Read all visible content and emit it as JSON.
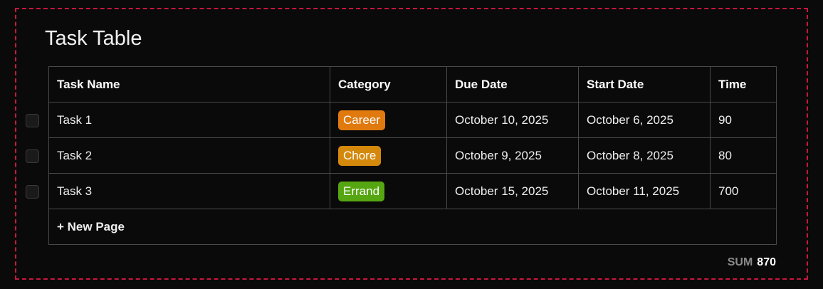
{
  "title": "Task Table",
  "table": {
    "headers": {
      "name": "Task Name",
      "category": "Category",
      "due": "Due Date",
      "start": "Start Date",
      "time": "Time"
    },
    "rows": [
      {
        "name": "Task 1",
        "category": "Career",
        "category_color": "#e07a0f",
        "due": "October 10, 2025",
        "start": "October 6, 2025",
        "time": "90"
      },
      {
        "name": "Task 2",
        "category": "Chore",
        "category_color": "#d4880c",
        "due": "October 9, 2025",
        "start": "October 8, 2025",
        "time": "80"
      },
      {
        "name": "Task 3",
        "category": "Errand",
        "category_color": "#56a612",
        "due": "October 15, 2025",
        "start": "October 11, 2025",
        "time": "700"
      }
    ],
    "new_page_label": "+ New Page"
  },
  "footer": {
    "sum_label": "SUM",
    "sum_value": "870"
  },
  "colors": {
    "background": "#0a0a0a",
    "frame_border": "#c8163f",
    "grid": "#4a4a4a"
  }
}
